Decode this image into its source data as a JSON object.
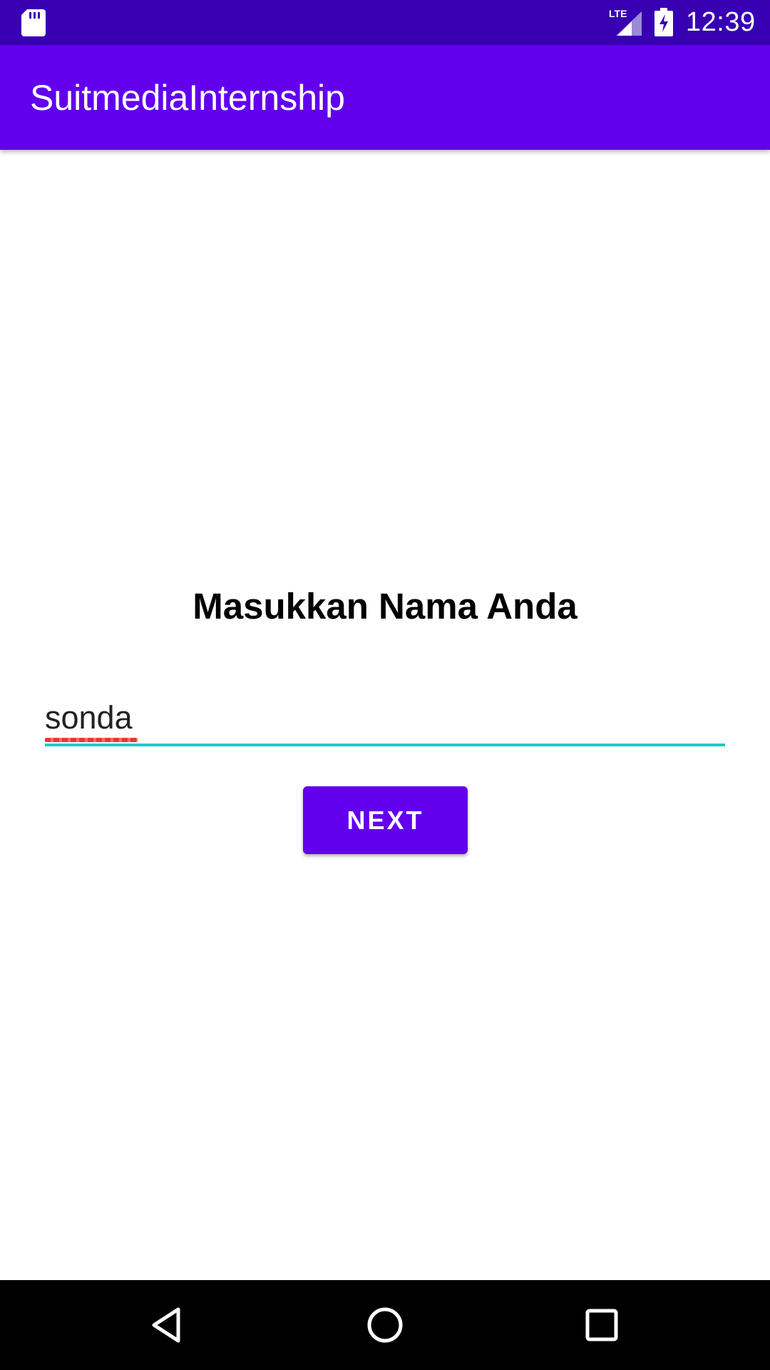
{
  "status_bar": {
    "time": "12:39",
    "network": "LTE",
    "icons": [
      "sd-card-icon",
      "lte-signal-icon",
      "battery-charging-icon"
    ]
  },
  "app_bar": {
    "title": "SuitmediaInternship"
  },
  "main": {
    "prompt": "Masukkan Nama Anda",
    "name_input": {
      "value": "sonda",
      "placeholder": ""
    },
    "next_button_label": "NEXT"
  },
  "nav_bar": {
    "icons": [
      "back-icon",
      "home-icon",
      "recents-icon"
    ]
  },
  "colors": {
    "status_bar": "#3700b3",
    "primary": "#6200ee",
    "input_underline": "#1ecbc1",
    "spell_error": "#e53935"
  }
}
